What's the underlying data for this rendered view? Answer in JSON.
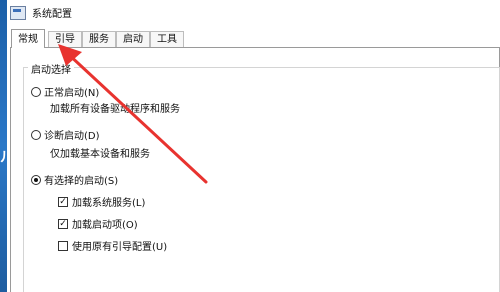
{
  "window": {
    "title": "系统配置"
  },
  "tabs": [
    {
      "label": "常规",
      "active": true
    },
    {
      "label": "引导",
      "active": false
    },
    {
      "label": "服务",
      "active": false
    },
    {
      "label": "启动",
      "active": false
    },
    {
      "label": "工具",
      "active": false
    }
  ],
  "startup": {
    "group_title": "启动选择",
    "normal": {
      "label": "正常启动(N)",
      "description": "加载所有设备驱动程序和服务",
      "selected": false
    },
    "diagnostic": {
      "label": "诊断启动(D)",
      "description": "仅加载基本设备和服务",
      "selected": false
    },
    "selective": {
      "label": "有选择的启动(S)",
      "selected": true,
      "options": [
        {
          "label": "加载系统服务(L)",
          "checked": true
        },
        {
          "label": "加载启动项(O)",
          "checked": true
        },
        {
          "label": "使用原有引导配置(U)",
          "checked": false
        }
      ]
    }
  },
  "annotation": {
    "color": "#e8332f"
  },
  "desktop_fragment": "ル"
}
